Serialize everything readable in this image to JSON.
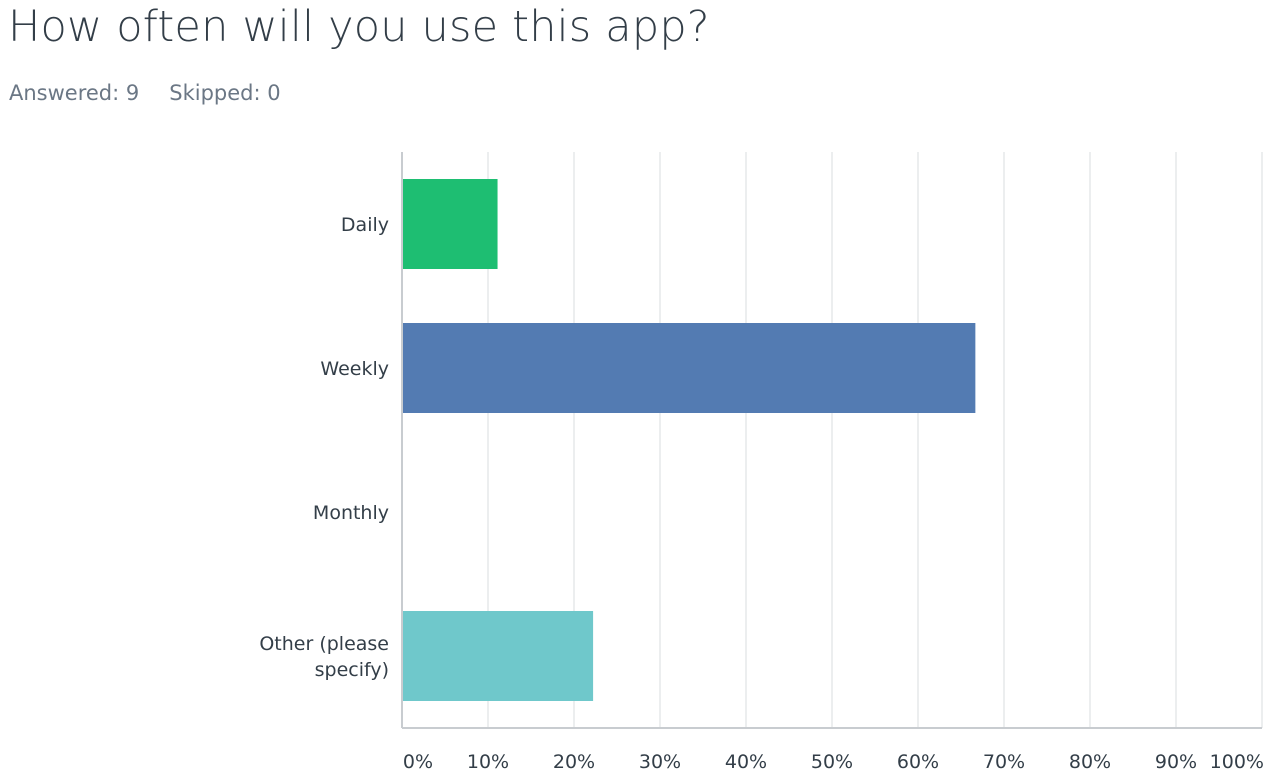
{
  "question": {
    "title": "How often will you use this app?"
  },
  "stats": {
    "answered": "Answered: 9",
    "skipped": "Skipped: 0"
  },
  "colors": {
    "grid": "#e6e8ea",
    "axis": "#c8ccd0",
    "text": "#333e48",
    "muted": "#6b7785"
  },
  "chart_data": {
    "type": "bar",
    "orientation": "horizontal",
    "categories": [
      [
        "Daily"
      ],
      [
        "Weekly"
      ],
      [
        "Monthly"
      ],
      [
        "Other (please",
        "specify)"
      ]
    ],
    "values": [
      11.11,
      66.67,
      0,
      22.22
    ],
    "bar_colors": [
      "#1ebe72",
      "#537bb2",
      "#f1a843",
      "#6fc8cb"
    ],
    "xlim": [
      0,
      100
    ],
    "xticks": [
      0,
      10,
      20,
      30,
      40,
      50,
      60,
      70,
      80,
      90,
      100
    ],
    "tick_labels": [
      "0%",
      "10%",
      "20%",
      "30%",
      "40%",
      "50%",
      "60%",
      "70%",
      "80%",
      "90%",
      "100%"
    ],
    "grid": true,
    "legend": false
  }
}
